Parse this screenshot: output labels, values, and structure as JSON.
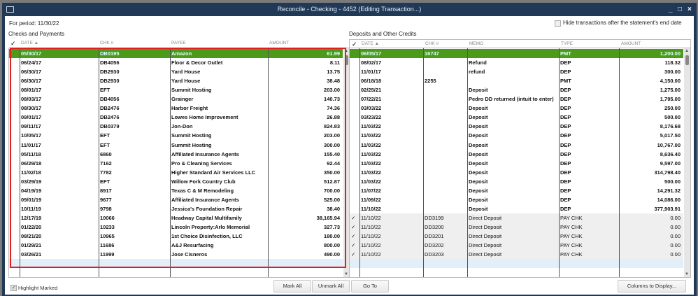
{
  "window": {
    "title": "Reconcile - Checking - 4452 (Editing Transaction...)",
    "minimize": "_",
    "maximize": "□",
    "close": "×"
  },
  "period": "For period: 11/30/22",
  "hide_label": "Hide transactions after the statement's end date",
  "left": {
    "title": "Checks and Payments",
    "headers": [
      "✓",
      "DATE ▲",
      "CHK #",
      "PAYEE",
      "AMOUNT"
    ],
    "rows": [
      [
        "05/30/17",
        "DB0195",
        "Amazon",
        "61.99"
      ],
      [
        "06/24/17",
        "DB4056",
        "Floor & Decor Outlet",
        "8.11"
      ],
      [
        "06/30/17",
        "DB2930",
        "Yard House",
        "13.75"
      ],
      [
        "06/30/17",
        "DB2930",
        "Yard House",
        "38.48"
      ],
      [
        "08/01/17",
        "EFT",
        "Summit Hosting",
        "203.00"
      ],
      [
        "08/03/17",
        "DB4056",
        "Grainger",
        "140.73"
      ],
      [
        "08/30/17",
        "DB2476",
        "Harbor Freight",
        "74.36"
      ],
      [
        "09/01/17",
        "DB2476",
        "Lowes Home Improvement",
        "26.88"
      ],
      [
        "09/11/17",
        "DB0379",
        "Jon-Don",
        "824.83"
      ],
      [
        "10/05/17",
        "EFT",
        "Summit Hosting",
        "203.00"
      ],
      [
        "11/01/17",
        "EFT",
        "Summit Hosting",
        "300.00"
      ],
      [
        "05/11/18",
        "6860",
        "Affiliated Insurance Agents",
        "155.40"
      ],
      [
        "06/29/18",
        "7162",
        "Pro & Cleaning Services",
        "92.44"
      ],
      [
        "11/02/18",
        "7782",
        "Higher Standard Air Services LLC",
        "350.00"
      ],
      [
        "03/29/19",
        "EFT",
        "Willow Fork Country Club",
        "512.87"
      ],
      [
        "04/19/19",
        "8917",
        "Texas C & M Remodeling",
        "700.00"
      ],
      [
        "09/01/19",
        "9677",
        "Affiliated Insurance Agents",
        "525.00"
      ],
      [
        "10/11/19",
        "9798",
        "Jessica's Foundation Repair",
        "38.40"
      ],
      [
        "12/17/19",
        "10066",
        "Headway Capital Multifamily",
        "38,165.94"
      ],
      [
        "01/22/20",
        "10233",
        "Lincoln Property:Arlo Memorial",
        "327.73"
      ],
      [
        "08/21/20",
        "10965",
        "1st Choice Disinfection, LLC",
        "180.00"
      ],
      [
        "01/29/21",
        "11686",
        "A&J Resurfacing",
        "800.00"
      ],
      [
        "03/26/21",
        "11999",
        "Jose Cisneros",
        "490.00"
      ]
    ]
  },
  "right": {
    "title": "Deposits and Other Credits",
    "headers": [
      "✓",
      "DATE ▲",
      "CHK #",
      "MEMO",
      "TYPE",
      "AMOUNT"
    ],
    "rows": [
      [
        "",
        "06/05/17",
        "16747",
        "",
        "PMT",
        "1,200.00"
      ],
      [
        "",
        "08/02/17",
        "",
        "Refund",
        "DEP",
        "118.32"
      ],
      [
        "",
        "11/01/17",
        "",
        "refund",
        "DEP",
        "300.00"
      ],
      [
        "",
        "06/18/18",
        "2255",
        "",
        "PMT",
        "4,150.00"
      ],
      [
        "",
        "02/25/21",
        "",
        "Deposit",
        "DEP",
        "1,275.00"
      ],
      [
        "",
        "07/22/21",
        "",
        "Pedro DD returned (intuit to enter)",
        "DEP",
        "1,795.00"
      ],
      [
        "",
        "03/03/22",
        "",
        "Deposit",
        "DEP",
        "250.00"
      ],
      [
        "",
        "03/23/22",
        "",
        "Deposit",
        "DEP",
        "500.00"
      ],
      [
        "",
        "11/03/22",
        "",
        "Deposit",
        "DEP",
        "8,176.68"
      ],
      [
        "",
        "11/03/22",
        "",
        "Deposit",
        "DEP",
        "5,017.50"
      ],
      [
        "",
        "11/03/22",
        "",
        "Deposit",
        "DEP",
        "10,767.00"
      ],
      [
        "",
        "11/03/22",
        "",
        "Deposit",
        "DEP",
        "8,636.40"
      ],
      [
        "",
        "11/03/22",
        "",
        "Deposit",
        "DEP",
        "9,597.00"
      ],
      [
        "",
        "11/03/22",
        "",
        "Deposit",
        "DEP",
        "314,798.40"
      ],
      [
        "",
        "11/03/22",
        "",
        "Deposit",
        "DEP",
        "500.00"
      ],
      [
        "",
        "11/07/22",
        "",
        "Deposit",
        "DEP",
        "14,291.32"
      ],
      [
        "",
        "11/09/22",
        "",
        "Deposit",
        "DEP",
        "14,086.00"
      ],
      [
        "",
        "11/10/22",
        "",
        "Deposit",
        "DEP",
        "377,903.91"
      ],
      [
        "✓",
        "11/10/22",
        "DD3199",
        "Direct Deposit",
        "PAY CHK",
        "0.00"
      ],
      [
        "✓",
        "11/10/22",
        "DD3200",
        "Direct Deposit",
        "PAY CHK",
        "0.00"
      ],
      [
        "✓",
        "11/10/22",
        "DD3201",
        "Direct Deposit",
        "PAY CHK",
        "0.00"
      ],
      [
        "✓",
        "11/10/22",
        "DD3202",
        "Direct Deposit",
        "PAY CHK",
        "0.00"
      ],
      [
        "✓",
        "11/10/22",
        "DD3203",
        "Direct Deposit",
        "PAY CHK",
        "0.00"
      ]
    ]
  },
  "footer": {
    "highlight_label": "Highlight Marked",
    "mark_all": "Mark All",
    "unmark_all": "Unmark All",
    "go_to": "Go To",
    "columns": "Columns to Display..."
  },
  "colors": {
    "selected": "#4c9a1a",
    "highlight_box": "#e02020",
    "frame": "#1f3957"
  }
}
